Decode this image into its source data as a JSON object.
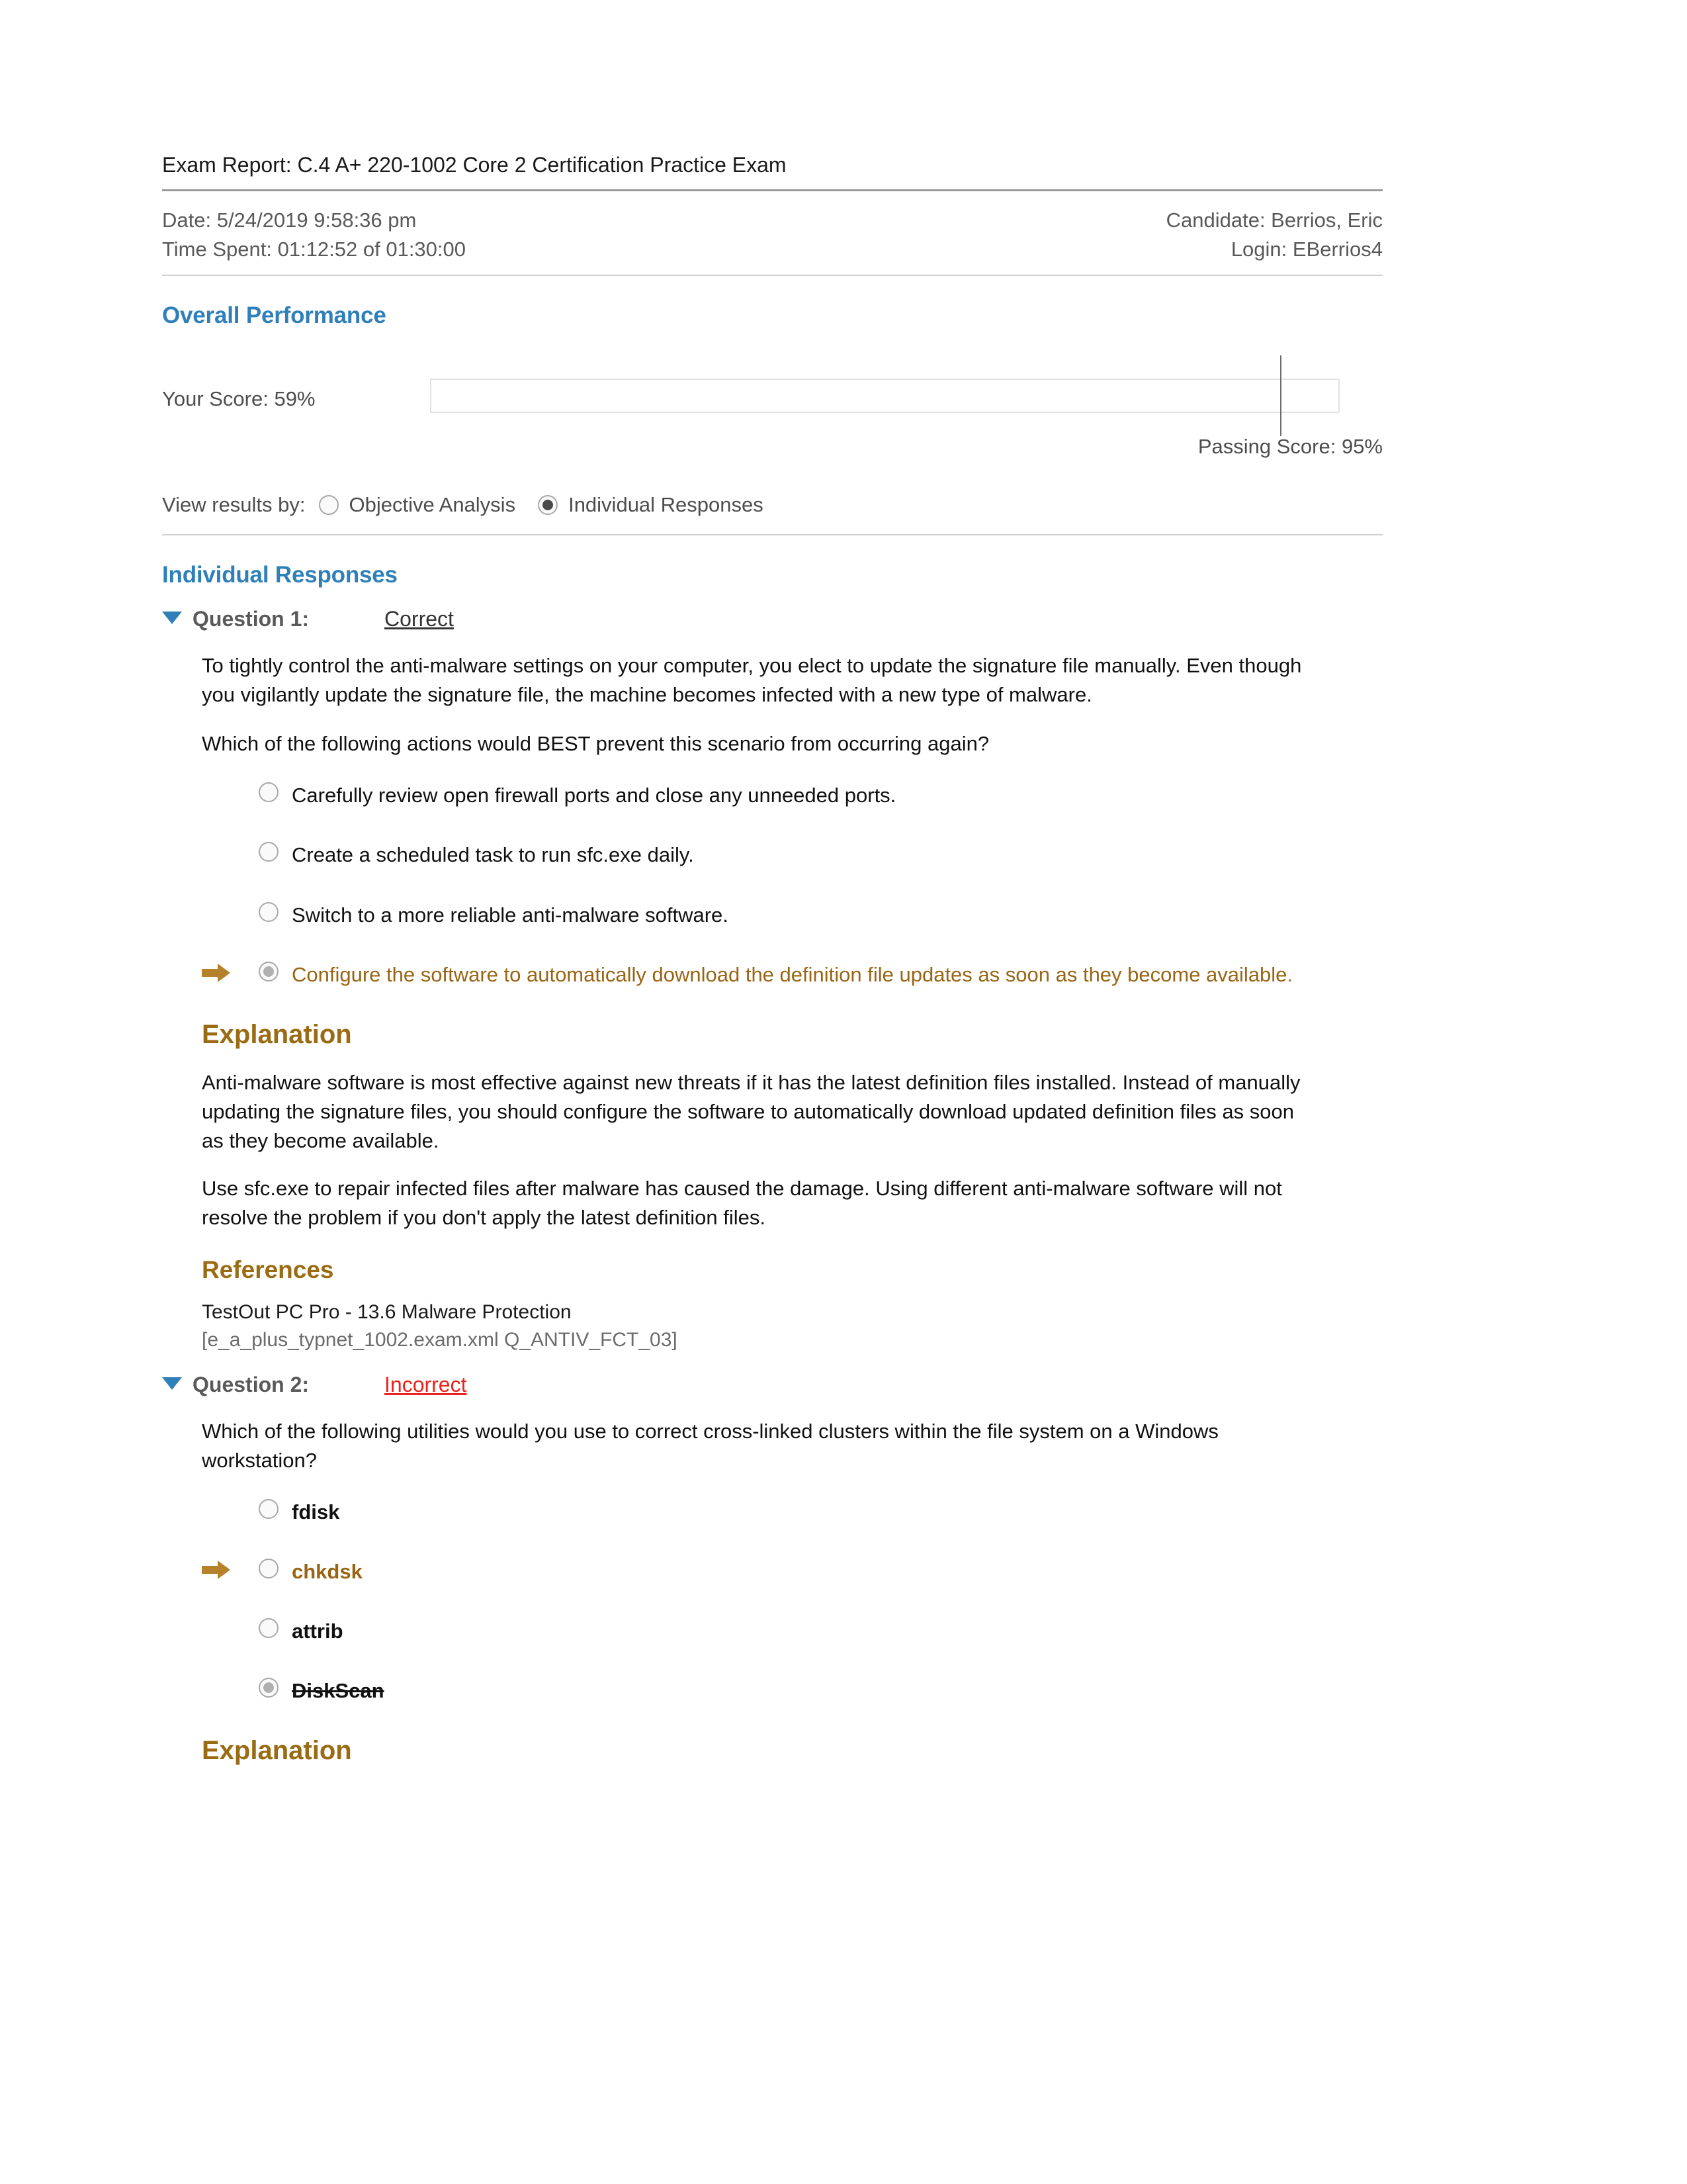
{
  "report": {
    "title": "Exam Report: C.4 A+ 220-1002 Core 2 Certification Practice Exam",
    "date_label": "Date: 5/24/2019 9:58:36 pm",
    "time_spent_label": "Time Spent: 01:12:52 of 01:30:00",
    "candidate_label": "Candidate: Berrios, Eric",
    "login_label": "Login: EBerrios4"
  },
  "overall_performance": {
    "heading": "Overall Performance",
    "your_score_label": "Your Score: 59%",
    "passing_score_label": "Passing Score: 95%",
    "your_score_percent": 59,
    "passing_score_percent": 95
  },
  "view_results": {
    "label": "View results by:",
    "options": [
      {
        "label": "Objective Analysis",
        "selected": false
      },
      {
        "label": "Individual Responses",
        "selected": true
      }
    ]
  },
  "individual_responses": {
    "heading": "Individual Responses",
    "questions": [
      {
        "label": "Question 1:",
        "status": "Correct",
        "status_type": "correct",
        "paragraphs": [
          "To tightly control the anti-malware settings on your computer, you elect to update the signature file manually. Even though you vigilantly update the signature file, the machine becomes infected with a new type of malware.",
          "Which of the following actions would BEST prevent this scenario from occurring again?"
        ],
        "options": [
          {
            "text": "Carefully review open firewall ports and close any unneeded ports.",
            "selected": false,
            "highlighted": false,
            "arrow": false,
            "bold": false,
            "struck": false
          },
          {
            "text": "Create a scheduled task to run sfc.exe daily.",
            "selected": false,
            "highlighted": false,
            "arrow": false,
            "bold": false,
            "struck": false
          },
          {
            "text": "Switch to a more reliable anti-malware software.",
            "selected": false,
            "highlighted": false,
            "arrow": false,
            "bold": false,
            "struck": false
          },
          {
            "text": "Configure the software to automatically download the definition file updates as soon as they become available.",
            "selected": true,
            "highlighted": true,
            "arrow": true,
            "bold": false,
            "struck": false
          }
        ],
        "explanation_heading": "Explanation",
        "explanation_paragraphs": [
          "Anti-malware software is most effective against new threats if it has the latest definition files installed. Instead of manually updating the signature files, you should configure the software to automatically download updated definition files as soon as they become available.",
          "Use sfc.exe to repair infected files after malware has caused the damage. Using different anti-malware software will not resolve the problem if you don't apply the latest definition files."
        ],
        "references_heading": "References",
        "reference_title": "TestOut PC Pro - 13.6 Malware Protection",
        "reference_id": "[e_a_plus_typnet_1002.exam.xml Q_ANTIV_FCT_03]"
      },
      {
        "label": "Question 2:",
        "status": "Incorrect",
        "status_type": "incorrect",
        "paragraphs": [
          "Which of the following utilities would you use to correct cross-linked clusters within the file system on a Windows workstation?"
        ],
        "options": [
          {
            "text": "fdisk",
            "selected": false,
            "highlighted": false,
            "arrow": false,
            "bold": true,
            "struck": false
          },
          {
            "text": "chkdsk",
            "selected": false,
            "highlighted": true,
            "arrow": true,
            "bold": true,
            "struck": false
          },
          {
            "text": "attrib",
            "selected": false,
            "highlighted": false,
            "arrow": false,
            "bold": true,
            "struck": false
          },
          {
            "text": "DiskScan",
            "selected": true,
            "highlighted": false,
            "arrow": false,
            "bold": true,
            "struck": true
          }
        ],
        "explanation_heading": "Explanation"
      }
    ]
  },
  "colors": {
    "section_heading": "#2e7fba",
    "sub_heading": "#9a6b12",
    "highlight_gold": "#996515",
    "incorrect_red": "#e8241c",
    "body_text": "#111111"
  }
}
